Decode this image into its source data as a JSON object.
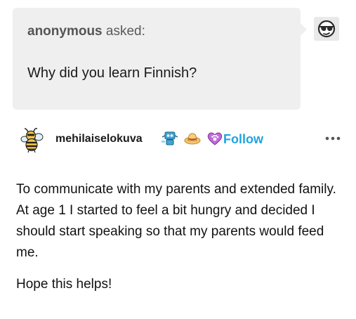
{
  "ask": {
    "asker": "anonymous",
    "asked_label": "asked:",
    "question": "Why did you learn Finnish?"
  },
  "avatars": {
    "anonymous": "sunglasses-face-icon",
    "blog": "bee-icon"
  },
  "post": {
    "blog_name": "mehilaiselokuva",
    "badges": [
      "robot-badge-icon",
      "straw-hat-badge-icon",
      "paw-heart-badge-icon"
    ],
    "follow_label": "Follow",
    "more_icon": "ellipsis-icon",
    "body_paragraphs": [
      "To communicate with my parents and extended family. At age 1 I started to feel a bit hungry and decided I should start speaking so that my parents would feed me.",
      "Hope this helps!"
    ]
  },
  "colors": {
    "ask_background": "#efefef",
    "follow_link": "#1fa4e0",
    "text": "#121212",
    "muted_text": "#5a5a5a"
  }
}
